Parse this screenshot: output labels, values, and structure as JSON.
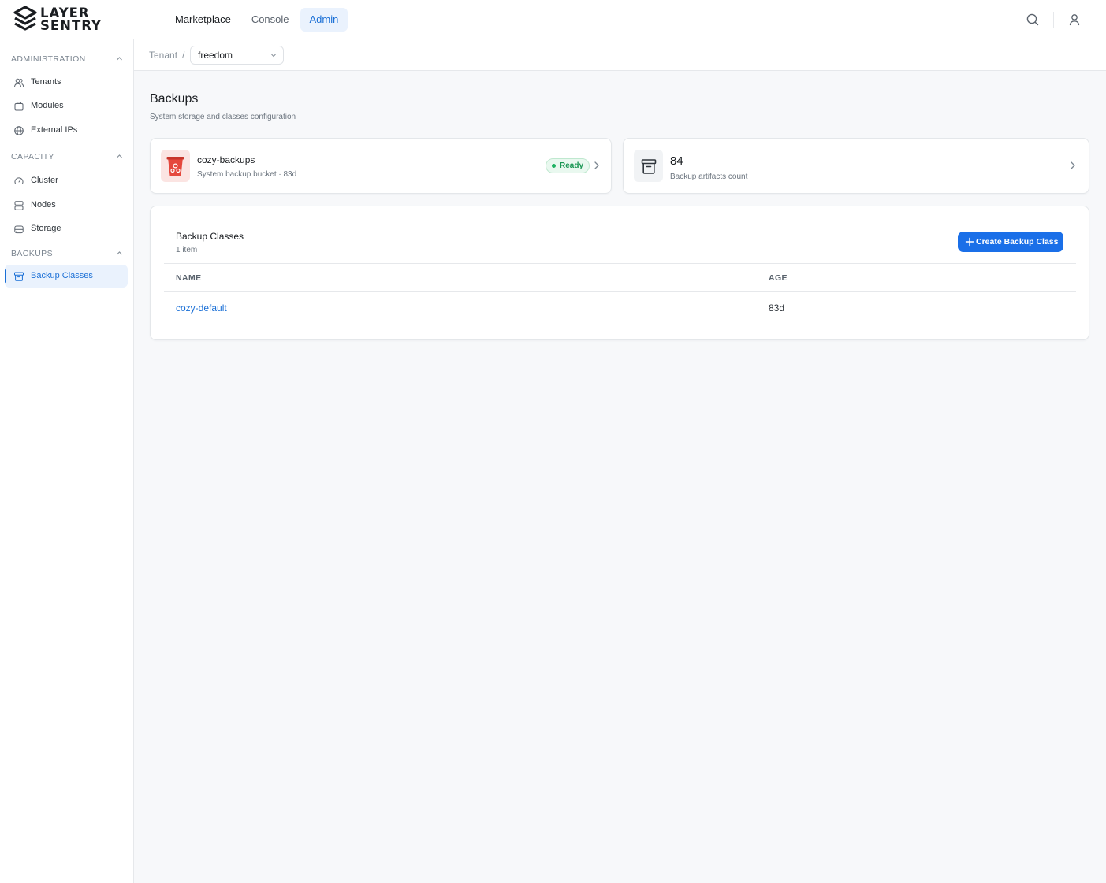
{
  "brand": {
    "line1": "LAYER",
    "line2": "SENTRY"
  },
  "nav": {
    "tabs": [
      {
        "label": "Marketplace"
      },
      {
        "label": "Console"
      },
      {
        "label": "Admin",
        "active": true
      }
    ]
  },
  "topbar": {
    "icons": [
      "search-icon",
      "user-icon"
    ]
  },
  "sidebar": {
    "sections": [
      {
        "title": "ADMINISTRATION",
        "items": [
          {
            "label": "Tenants",
            "icon": "users-icon"
          },
          {
            "label": "Modules",
            "icon": "box-icon"
          },
          {
            "label": "External IPs",
            "icon": "globe-icon"
          }
        ]
      },
      {
        "title": "CAPACITY",
        "items": [
          {
            "label": "Cluster",
            "icon": "gauge-icon"
          },
          {
            "label": "Nodes",
            "icon": "server-icon"
          },
          {
            "label": "Storage",
            "icon": "storage-icon"
          }
        ]
      },
      {
        "title": "BACKUPS",
        "items": [
          {
            "label": "Backup Classes",
            "icon": "archive-icon",
            "active": true
          }
        ]
      }
    ]
  },
  "breadcrumb": {
    "label": "Tenant",
    "separator": "/",
    "tenant": "freedom"
  },
  "page": {
    "title": "Backups",
    "subtitle": "System storage and classes configuration"
  },
  "bucket": {
    "name": "cozy-backups",
    "meta": "System backup bucket · 83d",
    "status": "Ready"
  },
  "artifacts": {
    "count": "84",
    "label": "Backup artifacts count"
  },
  "backup_classes": {
    "title": "Backup Classes",
    "count": "1 item",
    "create_label": "Create Backup Class",
    "columns": [
      "NAME",
      "AGE"
    ],
    "rows": [
      {
        "name": "cozy-default",
        "age": "83d"
      }
    ]
  },
  "colors": {
    "accent": "#1a6fd6",
    "button": "#1a6fe8",
    "ready": "#1a9653",
    "bucket_icon": "#e5483d"
  }
}
